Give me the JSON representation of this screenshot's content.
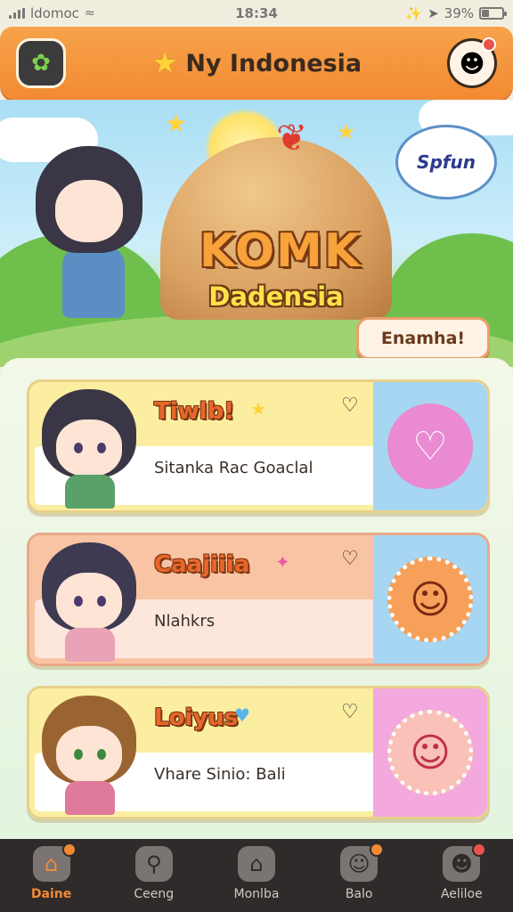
{
  "status_bar": {
    "carrier": "ldomoc",
    "time": "18:34",
    "battery": "39%"
  },
  "app_bar": {
    "title": "Ny Indonesia"
  },
  "hero": {
    "title": "KOMK",
    "subtitle": "Dadensia",
    "speech_bubble": "Spfun",
    "cta_label": "Enamha!"
  },
  "cards": [
    {
      "name": "Tiwlb!",
      "description": "Sitanka Rac Goaclal",
      "color_main": "#fbeea0",
      "color_side": "#a6d6f2",
      "mascot": "ghost",
      "hair": "#3a3646",
      "body": "#5aa06a"
    },
    {
      "name": "Caajiiia",
      "description": "Nlahkrs",
      "color_main": "#f9c4a4",
      "color_side": "#a6d6f2",
      "mascot": "sun-face",
      "hair": "#3e3a52",
      "body": "#e9a3b6"
    },
    {
      "name": "Loiyus",
      "description": "Vhare Sinio: Bali",
      "color_main": "#fbeea0",
      "color_side": "#f3a9dd",
      "mascot": "bear-face",
      "hair": "#9a6432",
      "body": "#e07a9b"
    }
  ],
  "bottom_nav": [
    {
      "label": "Daine",
      "icon": "home-icon",
      "badge": true,
      "active": true
    },
    {
      "label": "Ceeng",
      "icon": "search-icon",
      "badge": false,
      "active": false
    },
    {
      "label": "Monlba",
      "icon": "house-icon",
      "badge": false,
      "active": false
    },
    {
      "label": "Balo",
      "icon": "chat-icon",
      "badge": true,
      "active": false
    },
    {
      "label": "Aeliloe",
      "icon": "profile-icon",
      "badge": true,
      "active": false
    }
  ]
}
